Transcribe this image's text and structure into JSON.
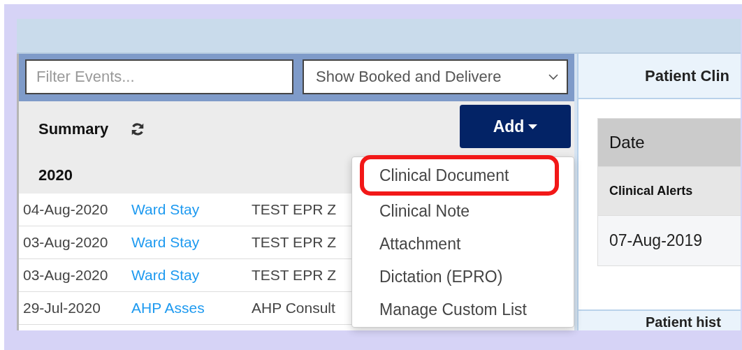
{
  "filter": {
    "placeholder": "Filter Events..."
  },
  "view_select": {
    "value": "Show Booked and Delivere"
  },
  "summary": {
    "title": "Summary"
  },
  "add_button": {
    "label": "Add",
    "expanded": true
  },
  "add_menu": [
    {
      "label": "Clinical Document",
      "highlighted": true
    },
    {
      "label": "Clinical Note",
      "highlighted": false
    },
    {
      "label": "Attachment",
      "highlighted": false
    },
    {
      "label": "Dictation (EPRO)",
      "highlighted": false
    },
    {
      "label": "Manage Custom List",
      "highlighted": false
    }
  ],
  "events": {
    "year": "2020",
    "rows": [
      {
        "date": "04-Aug-2020",
        "type": "Ward Stay",
        "description": "TEST EPR Z"
      },
      {
        "date": "03-Aug-2020",
        "type": "Ward Stay",
        "description": "TEST EPR Z"
      },
      {
        "date": "03-Aug-2020",
        "type": "Ward Stay",
        "description": "TEST EPR Z"
      },
      {
        "date": "29-Jul-2020",
        "type": "AHP Asses",
        "description": "AHP Consult"
      }
    ]
  },
  "patient_panel": {
    "title": "Patient Clin",
    "table": {
      "columns": [
        "Date"
      ],
      "section": "Clinical Alerts",
      "rows": [
        [
          "07-Aug-2019"
        ]
      ]
    }
  },
  "history_panel": {
    "title": "Patient hist"
  }
}
